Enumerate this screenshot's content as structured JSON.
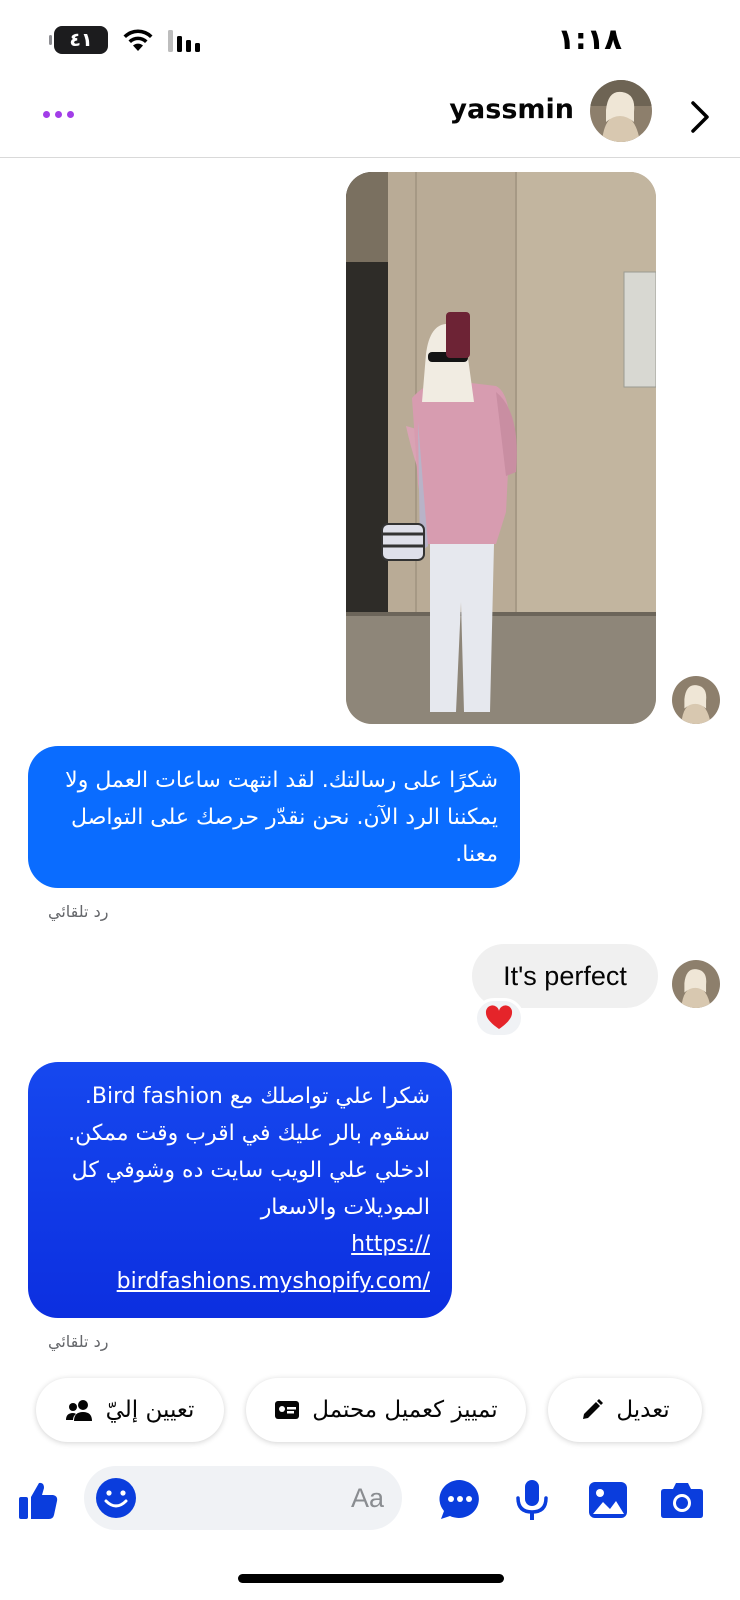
{
  "status_bar": {
    "time": "١:١٨",
    "battery": "٤١"
  },
  "header": {
    "name": "yassmin"
  },
  "messages": {
    "bot_reply_1": {
      "lines": [
        "شكرًا على رسالتك. لقد انتهت ساعات العمل ولا",
        "يمكننا الرد الآن. نحن نقدّر حرصك على التواصل",
        "معنا."
      ],
      "label": "رد تلقائي"
    },
    "incoming": {
      "text": "It's perfect",
      "reaction": "heart"
    },
    "bot_reply_2": {
      "lines": [
        "شكرا علي تواصلك مع Bird fashion.",
        "سنقوم بالر عليك في اقرب وقت ممكن.",
        "ادخلي علي الويب سايت ده وشوفي كل",
        "الموديلات والاسعار"
      ],
      "link_lines": [
        "https://",
        "birdfashions.myshopify.com/"
      ],
      "label": "رد تلقائي"
    }
  },
  "quick_actions": {
    "edit": "تعديل",
    "mark_lead": "تمييز كعميل محتمل",
    "assign_me": "تعيين إليّ"
  },
  "composer": {
    "placeholder": "Aa"
  },
  "colors": {
    "accent": "#0a6cff",
    "composer_icons": "#0a3ddd",
    "menu_dots": "#a23de8"
  }
}
